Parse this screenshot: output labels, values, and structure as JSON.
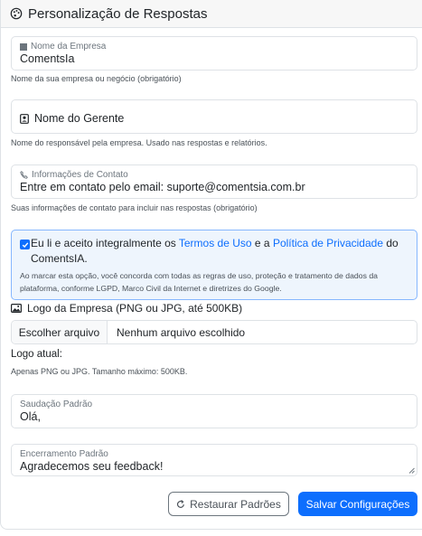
{
  "header": {
    "title": "Personalização de Respostas",
    "icon": "palette-icon"
  },
  "company": {
    "label": "Nome da Empresa",
    "value": "ComentsIa",
    "help": "Nome da sua empresa ou negócio (obrigatório)"
  },
  "manager": {
    "placeholder": "Nome do Gerente",
    "help": "Nome do responsável pela empresa. Usado nas respostas e relatórios."
  },
  "contact": {
    "label": "Informações de Contato",
    "value": "Entre em contato pelo email: suporte@comentsia.com.br",
    "help": "Suas informações de contato para incluir nas respostas (obrigatório)"
  },
  "terms": {
    "checked": true,
    "text_pre": "Eu li e aceito integralmente os ",
    "link_terms": "Termos de Uso",
    "text_mid": " e a ",
    "link_privacy": "Política de Privacidade",
    "text_post": " do ComentsIA.",
    "description": "Ao marcar esta opção, você concorda com todas as regras de uso, proteção e tratamento de dados da plataforma, conforme LGPD, Marco Civil da Internet e diretrizes do Google."
  },
  "logo": {
    "label": "Logo da Empresa (PNG ou JPG, até 500KB)",
    "choose_button": "Escolher arquivo",
    "no_file": "Nenhum arquivo escolhido",
    "current_label": "Logo atual:",
    "help": "Apenas PNG ou JPG. Tamanho máximo: 500KB."
  },
  "greeting": {
    "label": "Saudação Padrão",
    "value": "Olá,"
  },
  "closing": {
    "label": "Encerramento Padrão",
    "value": "Agradecemos seu feedback!"
  },
  "buttons": {
    "reset": "Restaurar Padrões",
    "save": "Salvar Configurações"
  },
  "colors": {
    "primary": "#0d6efd",
    "border": "#dee2e6",
    "terms_bg": "#eef5fd"
  }
}
